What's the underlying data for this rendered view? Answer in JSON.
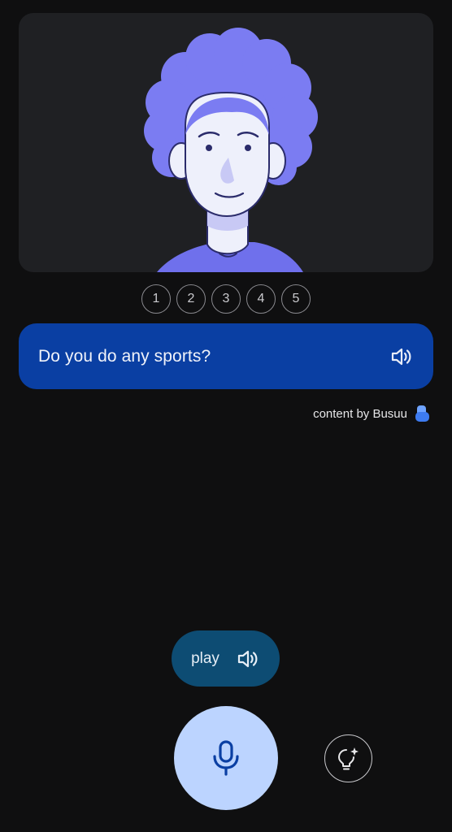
{
  "avatar": {
    "icon": "character-avatar-illustration",
    "hair_color": "#7b7cf2"
  },
  "steps": [
    "1",
    "2",
    "3",
    "4",
    "5"
  ],
  "prompt": {
    "text": "Do you do any sports?",
    "icon": "speaker-icon"
  },
  "credit": {
    "text": "content by Busuu",
    "icon": "busuu-logo-icon"
  },
  "play": {
    "label": "play",
    "icon": "speaker-icon"
  },
  "mic": {
    "icon": "microphone-icon"
  },
  "hint": {
    "icon": "lightbulb-sparkle-icon"
  },
  "colors": {
    "background": "#0f0f10",
    "card": "#1f2023",
    "prompt_bubble": "#0a3fa3",
    "play_button": "#0d4c73",
    "mic_button": "#bcd4ff",
    "mic_icon": "#0a3fa3"
  }
}
